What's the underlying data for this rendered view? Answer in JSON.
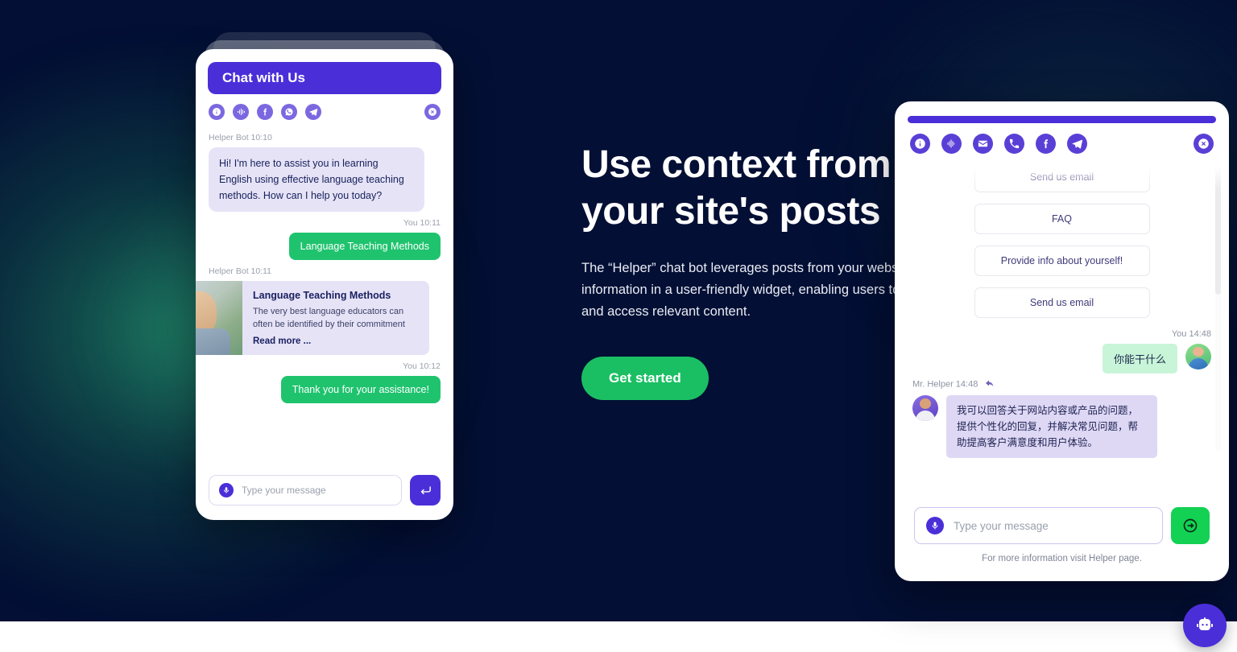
{
  "theme": {
    "bg_navy": "#030f34",
    "purple": "#4a2fd9",
    "green": "#1bbf63",
    "bot_bubble": "#e6e3f7",
    "me_bubble_green": "#1fc36e"
  },
  "hero": {
    "heading_line1": "Use context from",
    "heading_line2": "your site's posts",
    "paragraph": "The “Helper” chat bot leverages posts from your website and presents the information in a user-friendly widget, enabling users to conveniently read and access relevant content.",
    "cta_label": "Get started"
  },
  "left_widget": {
    "title": "Chat with Us",
    "icons": [
      "info-icon",
      "voice-icon",
      "facebook-icon",
      "whatsapp-icon",
      "telegram-icon"
    ],
    "close_icon": "close-icon",
    "messages": [
      {
        "meta": "Helper Bot 10:10",
        "side": "bot",
        "text": "Hi! I'm here to assist you in learning English using effective language teaching methods. How can I help you today?"
      },
      {
        "meta": "You 10:11",
        "side": "me",
        "text": "Language Teaching Methods"
      },
      {
        "meta": "Helper Bot 10:11",
        "side": "bot-card"
      },
      {
        "meta": "You 10:12",
        "side": "me",
        "text": "Thank you for your assistance!"
      }
    ],
    "post_card": {
      "title": "Language Teaching Methods",
      "excerpt": "The very best language educators can often be identified by their commitment",
      "read_more": "Read more ..."
    },
    "input_placeholder": "Type your message",
    "mic_icon": "microphone-icon",
    "send_icon": "enter-arrow-icon"
  },
  "right_widget": {
    "icons": [
      "info-icon",
      "voice-icon",
      "email-icon",
      "phone-icon",
      "facebook-icon",
      "telegram-icon"
    ],
    "close_icon": "close-icon",
    "quick_replies": [
      "Send us email",
      "FAQ",
      "Provide info about yourself!",
      "Send us email"
    ],
    "messages": [
      {
        "meta": "You  14:48",
        "side": "me",
        "text": "你能干什么"
      },
      {
        "meta": "Mr. Helper 14:48",
        "side": "bot",
        "text": "我可以回答关于网站内容或产品的问题，提供个性化的回复，并解决常见问题，帮助提高客户满意度和用户体验。"
      }
    ],
    "input_placeholder": "Type your message",
    "mic_icon": "microphone-icon",
    "send_icon": "send-arrow-icon",
    "footer": "For more information visit Helper page."
  },
  "launcher": {
    "icon": "chat-bot-icon"
  }
}
